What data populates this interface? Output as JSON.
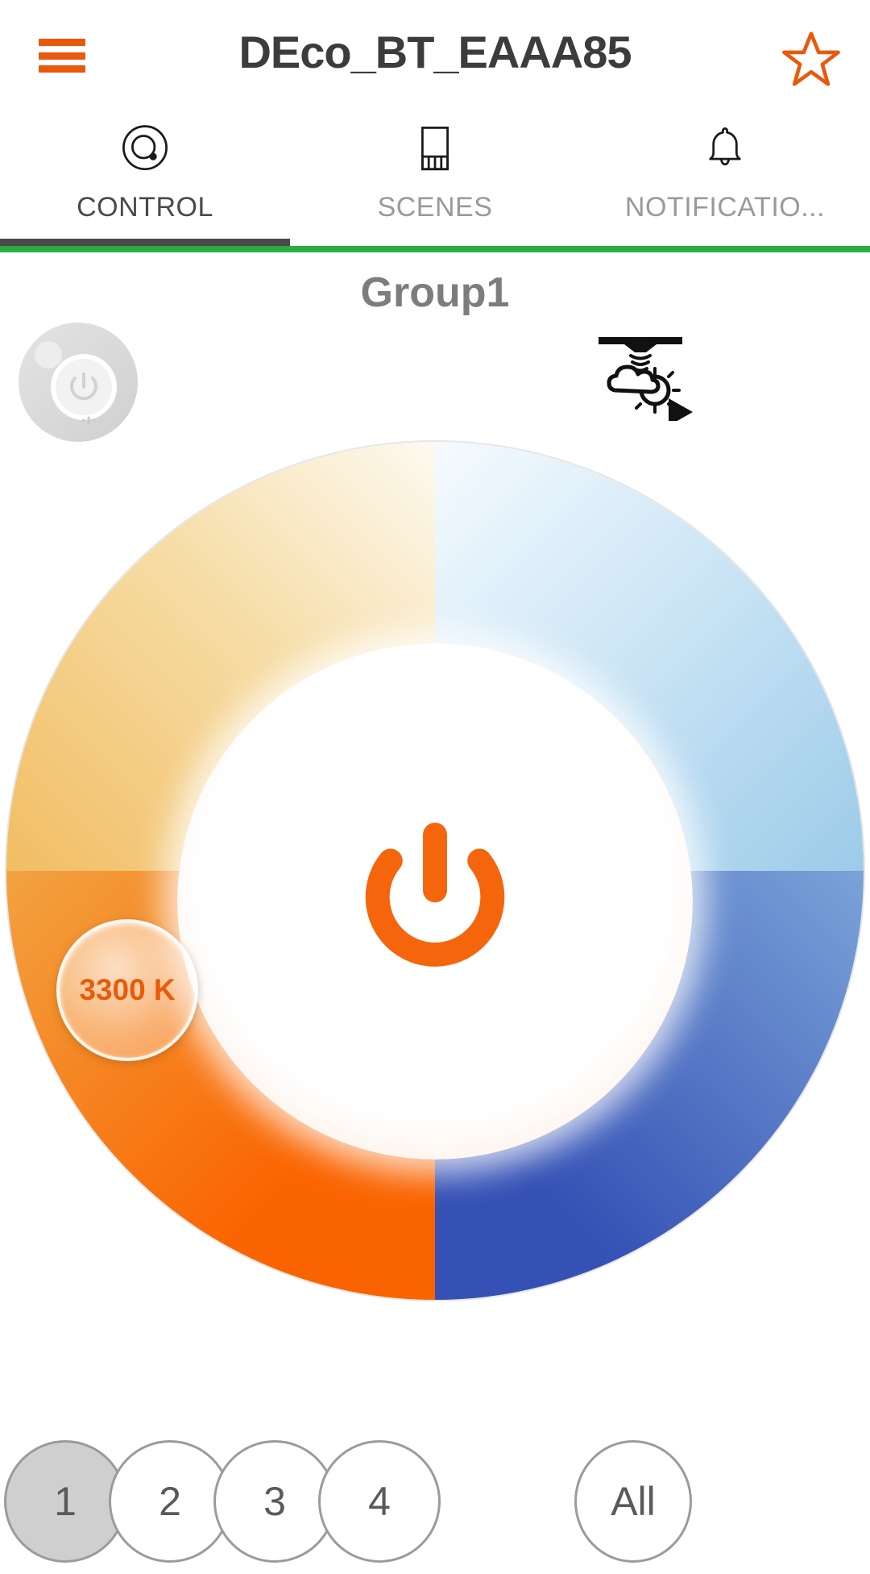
{
  "header": {
    "title": "DEco_BT_EAAA85",
    "menu_icon": "hamburger-icon",
    "favorite_icon": "star-icon"
  },
  "tabs": [
    {
      "label": "CONTROL",
      "icon": "dial-knob-icon",
      "active": true
    },
    {
      "label": "SCENES",
      "icon": "scene-panel-icon",
      "active": false
    },
    {
      "label": "NOTIFICATIO...",
      "icon": "bell-icon",
      "active": false
    }
  ],
  "main": {
    "group_title": "Group1",
    "device_chip_icon": "device-power-chip-icon",
    "daylight_sensor_icon": "daylight-sensor-icon",
    "power_icon": "power-icon",
    "temperature": {
      "value": "3300 K",
      "knob_label_color": "#ea5a0b"
    },
    "thermometer_warm_icon": "thermometer-warm-icon",
    "thermometer_cool_icon": "thermometer-cool-icon"
  },
  "zones": [
    {
      "label": "1",
      "selected": true
    },
    {
      "label": "2",
      "selected": false
    },
    {
      "label": "3",
      "selected": false
    },
    {
      "label": "4",
      "selected": false
    },
    {
      "label": "All",
      "selected": false
    }
  ],
  "colors": {
    "accent_orange": "#E8590C",
    "wheel_warm_bottom": "#FA6400",
    "wheel_cool_bottom": "#3551B5",
    "wheel_warm_top": "#F2BD63",
    "wheel_cool_top": "#9CCBE9",
    "rule_green": "#27AE3F",
    "tab_active": "#4A4A4A",
    "tab_inactive": "#9A9A9A",
    "title_gray": "#3C3C3C",
    "group_title_gray": "#7D7D7D"
  }
}
